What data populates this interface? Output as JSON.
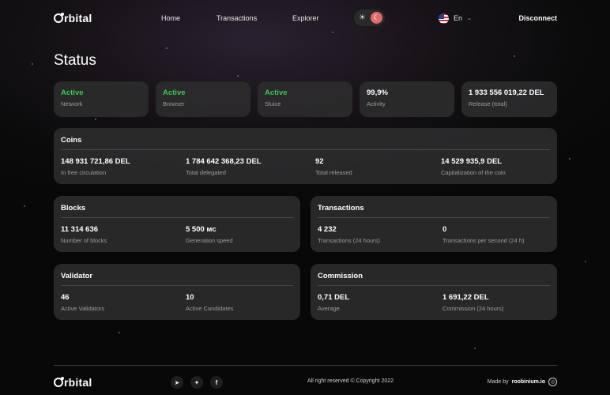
{
  "header": {
    "logo": "Orbital",
    "nav": {
      "home": "Home",
      "transactions": "Transactions",
      "explorer": "Explorer"
    },
    "language": "En",
    "disconnect": "Disconnect",
    "theme_icons": [
      "sun-icon",
      "moon-icon"
    ]
  },
  "page": {
    "title": "Status"
  },
  "status": [
    {
      "value": "Active",
      "label": "Network",
      "active": true
    },
    {
      "value": "Active",
      "label": "Browser",
      "active": true
    },
    {
      "value": "Active",
      "label": "Sluice",
      "active": true
    },
    {
      "value": "99,9%",
      "label": "Activity",
      "active": false
    },
    {
      "value": "1 933 556 019,22 DEL",
      "label": "Release (total)",
      "active": false
    }
  ],
  "coins": {
    "title": "Coins",
    "metrics": [
      {
        "value": "148 931 721,86 DEL",
        "label": "In free circulation"
      },
      {
        "value": "1 784 642 368,23 DEL",
        "label": "Total delegated"
      },
      {
        "value": "92",
        "label": "Total released"
      },
      {
        "value": "14 529 935,9 DEL",
        "label": "Capitalization of the coin"
      }
    ]
  },
  "blocks": {
    "title": "Blocks",
    "metrics": [
      {
        "value": "11 314 636",
        "label": "Number of blocks"
      },
      {
        "value": "5 500 мс",
        "label": "Generation speed"
      }
    ]
  },
  "transactions": {
    "title": "Transactions",
    "metrics": [
      {
        "value": "4 232",
        "label": "Transactions (24 hours)"
      },
      {
        "value": "0",
        "label": "Transactions per second (24 h)"
      }
    ]
  },
  "validator": {
    "title": "Validator",
    "metrics": [
      {
        "value": "46",
        "label": "Active Validators"
      },
      {
        "value": "10",
        "label": "Active Candidates"
      }
    ]
  },
  "commission": {
    "title": "Commission",
    "metrics": [
      {
        "value": "0,71 DEL",
        "label": "Average"
      },
      {
        "value": "1 691,22 DEL",
        "label": "Commission (24 hours)"
      }
    ]
  },
  "footer": {
    "logo": "Orbital",
    "social": [
      "telegram-icon",
      "twitter-icon",
      "facebook-icon"
    ],
    "copyright": "All right reserved © Copyright 2022",
    "made_by_prefix": "Made by",
    "made_by_name": "roobinium.io"
  },
  "colors": {
    "active": "#2ed14a",
    "card": "#2c2b2c",
    "background": "#0b0b0c"
  }
}
